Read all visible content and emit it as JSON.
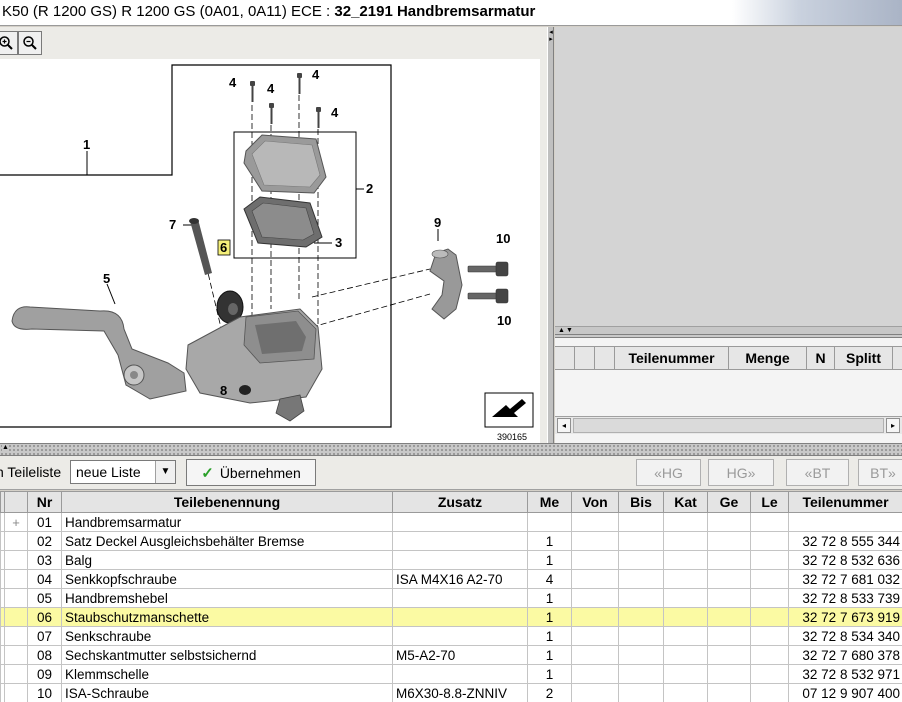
{
  "title": {
    "prefix": "K50 (R 1200 GS) R 1200 GS (0A01, 0A11) ECE : ",
    "group": "32_2191 Handbremsarmatur"
  },
  "diagram": {
    "image_number": "390165",
    "callouts": [
      "1",
      "2",
      "3",
      "4",
      "4",
      "4",
      "4",
      "5",
      "6",
      "7",
      "8",
      "9",
      "10",
      "10"
    ]
  },
  "zoom": {
    "zoom_in_icon": "zoom-in-icon",
    "zoom_out_icon": "zoom-out-icon"
  },
  "cart_table": {
    "columns": [
      "Teilenummer",
      "Menge",
      "N",
      "Splitt"
    ]
  },
  "toolbar": {
    "list_label": "n Teileliste",
    "list_value": "neue Liste",
    "apply_label": "Übernehmen",
    "nav": [
      "«HG",
      "HG»",
      "«BT",
      "BT»"
    ]
  },
  "parts": {
    "columns": [
      "Nr",
      "Teilebenennung",
      "Zusatz",
      "Me",
      "Von",
      "Bis",
      "Kat",
      "Ge",
      "Le",
      "Teilenummer"
    ],
    "rows": [
      {
        "expand": "+",
        "nr": "01",
        "name": "Handbremsarmatur",
        "zusatz": "",
        "me": "",
        "partno": ""
      },
      {
        "expand": "",
        "nr": "02",
        "name": "Satz Deckel Ausgleichsbehälter Bremse",
        "zusatz": "",
        "me": "1",
        "partno": "32 72 8 555 344"
      },
      {
        "expand": "",
        "nr": "03",
        "name": "Balg",
        "zusatz": "",
        "me": "1",
        "partno": "32 72 8 532 636"
      },
      {
        "expand": "",
        "nr": "04",
        "name": "Senkkopfschraube",
        "zusatz": "ISA M4X16 A2-70",
        "me": "4",
        "partno": "32 72 7 681 032"
      },
      {
        "expand": "",
        "nr": "05",
        "name": "Handbremshebel",
        "zusatz": "",
        "me": "1",
        "partno": "32 72 8 533 739"
      },
      {
        "expand": "",
        "nr": "06",
        "name": "Staubschutzmanschette",
        "zusatz": "",
        "me": "1",
        "partno": "32 72 7 673 919",
        "highlight": true
      },
      {
        "expand": "",
        "nr": "07",
        "name": "Senkschraube",
        "zusatz": "",
        "me": "1",
        "partno": "32 72 8 534 340"
      },
      {
        "expand": "",
        "nr": "08",
        "name": "Sechskantmutter selbstsichernd",
        "zusatz": "M5-A2-70",
        "me": "1",
        "partno": "32 72 7 680 378"
      },
      {
        "expand": "",
        "nr": "09",
        "name": "Klemmschelle",
        "zusatz": "",
        "me": "1",
        "partno": "32 72 8 532 971"
      },
      {
        "expand": "",
        "nr": "10",
        "name": "ISA-Schraube",
        "zusatz": "M6X30-8.8-ZNNIV",
        "me": "2",
        "partno": "07 12 9 907 400"
      }
    ]
  },
  "colors": {
    "highlight": "#fbfaa3",
    "callout_highlight": "#f5f07a"
  }
}
